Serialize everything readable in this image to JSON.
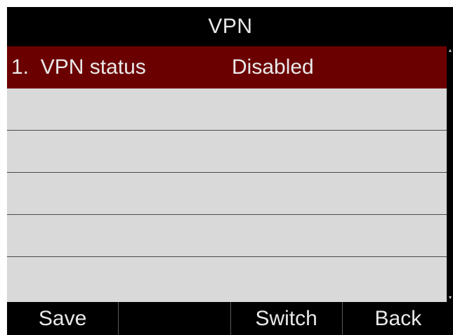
{
  "screen": {
    "title": "VPN"
  },
  "list": {
    "items": [
      {
        "label": "1.  VPN status",
        "value": "Disabled",
        "selected": true
      },
      {
        "label": "",
        "value": ""
      },
      {
        "label": "",
        "value": ""
      },
      {
        "label": "",
        "value": ""
      },
      {
        "label": "",
        "value": ""
      },
      {
        "label": "",
        "value": ""
      }
    ]
  },
  "softkeys": [
    {
      "label": "Save"
    },
    {
      "label": ""
    },
    {
      "label": "Switch"
    },
    {
      "label": "Back"
    }
  ],
  "colors": {
    "title_bar_bg": "#000000",
    "selected_row_bg": "#6b0000",
    "list_bg": "#d9d9d9",
    "softkey_bar_bg": "#000000"
  }
}
